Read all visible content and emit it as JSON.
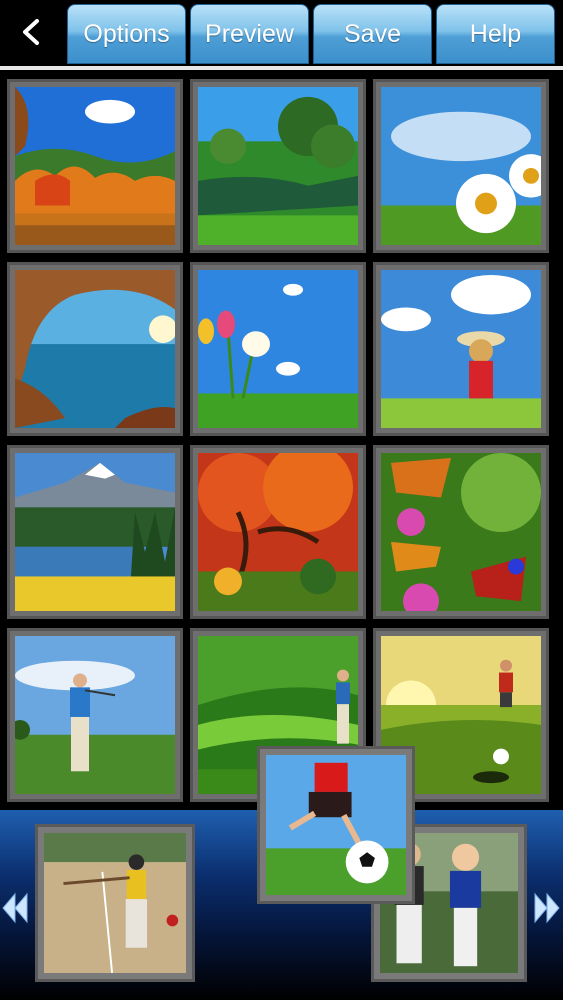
{
  "toolbar": {
    "back_icon": "back-chevron-icon",
    "tabs": [
      "Options",
      "Preview",
      "Save",
      "Help"
    ]
  },
  "colors": {
    "tab_gradient_top": "#b9e1f8",
    "tab_gradient_bottom": "#3b8fcb",
    "tray_top": "#1f5fb0",
    "thumb_frame": "#6e6e6e"
  },
  "grid": {
    "thumbnails": [
      {
        "subject": "autumn-lake-photo"
      },
      {
        "subject": "green-pond-photo"
      },
      {
        "subject": "daisy-sky-photo"
      },
      {
        "subject": "sea-cave-photo"
      },
      {
        "subject": "tulips-sky-photo"
      },
      {
        "subject": "girl-meadow-photo"
      },
      {
        "subject": "mountain-lake-photo"
      },
      {
        "subject": "red-tree-photo"
      },
      {
        "subject": "butterflies-photo"
      },
      {
        "subject": "golfer-photo"
      },
      {
        "subject": "golf-course-photo"
      },
      {
        "subject": "golf-sunset-photo"
      }
    ]
  },
  "tray": {
    "photos": [
      {
        "subject": "baseball-batter-photo"
      },
      {
        "subject": "soccer-kick-photo"
      },
      {
        "subject": "kids-baseball-photo"
      }
    ],
    "left_arrow_icon": "double-left-arrow-icon",
    "right_arrow_icon": "double-right-arrow-icon"
  }
}
